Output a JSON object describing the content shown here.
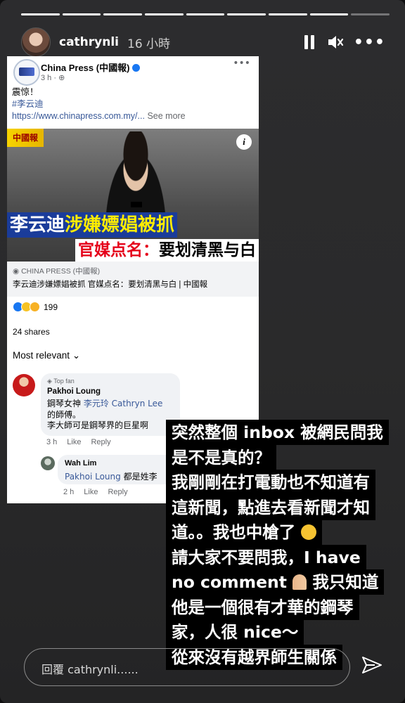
{
  "story": {
    "username": "cathrynli",
    "time": "16 小時",
    "progress": {
      "segments": 9,
      "completed": 8
    },
    "reply_placeholder": "回覆 cathrynli......"
  },
  "post": {
    "page_name": "China Press (中國報)",
    "meta": "3 h · ",
    "text": {
      "line1": "震惊！",
      "hashtag": "#李云迪",
      "link": "https://www.chinapress.com.my/...",
      "see_more": "See more"
    },
    "image": {
      "logo_text": "中國報",
      "headline1_a": "李云迪",
      "headline1_b": "涉嫌嫖娼被抓",
      "headline2_a": "官媒点名：",
      "headline2_b": "要划清黑与白"
    },
    "link_preview": {
      "source": "CHINA PRESS (中國報)",
      "title": "李云迪涉嫌嫖娼被抓 官媒点名：要划清黑与白 | 中國報"
    },
    "reactions": "199",
    "shares": "24 shares",
    "sort_label": "Most relevant"
  },
  "comments": [
    {
      "badge": "Top fan",
      "name": "Pakhoi Loung",
      "text_a": "鋼琴女神 ",
      "mention": "李元玲 Cathryn Lee",
      "text_b": "的師傅。",
      "text_c": "李大師可是鋼琴界的巨星啊",
      "time": "3 h",
      "like": "Like",
      "reply": "Reply"
    },
    {
      "name": "Wah Lim",
      "mention": "Pakhoi Loung",
      "text": " 都是姓李",
      "time": "2 h",
      "like": "Like",
      "reply": "Reply"
    }
  ],
  "caption": {
    "l1": "突然整個 inbox 被網民問我",
    "l2": "是不是真的？",
    "l3": "我剛剛在打電動也不知道有",
    "l4": "這新聞，點進去看新聞才知",
    "l5": "道。。我也中槍了",
    "l6": "請大家不要問我，I have",
    "l7": "no comment",
    "l7b": "我只知道",
    "l8": "他是一個很有才華的鋼琴",
    "l9": "家，人很 nice～",
    "l10": "從來沒有越界師生關係"
  }
}
